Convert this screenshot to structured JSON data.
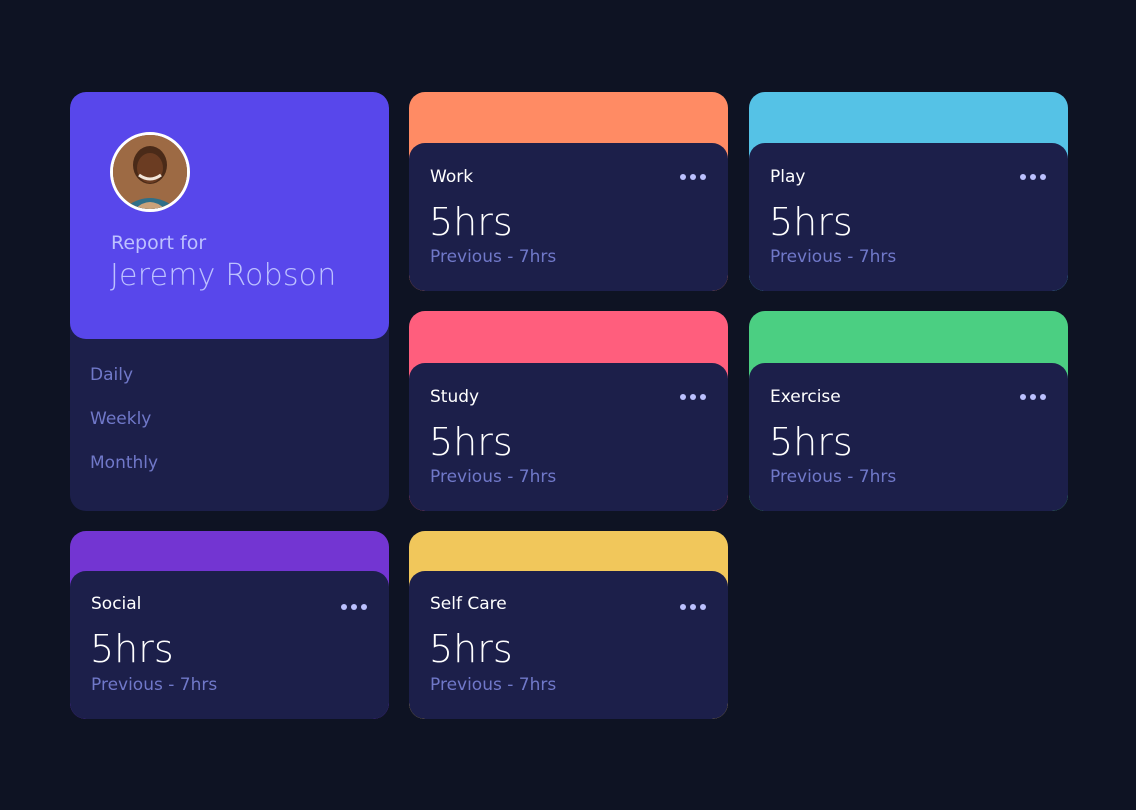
{
  "profile": {
    "report_for": "Report for",
    "name": "Jeremy Robson",
    "periods": [
      "Daily",
      "Weekly",
      "Monthly"
    ]
  },
  "colors": {
    "background": "#0e1323",
    "card": "#1c1f4a",
    "profile_accent": "#5847eb",
    "work": "#ff8b64",
    "play": "#55c2e6",
    "study": "#ff5e7d",
    "exercise": "#4bcf82",
    "social": "#7335d2",
    "self_care": "#f1c75b",
    "muted_text": "#7078c9",
    "pale_text": "#bdc1ff"
  },
  "cards": [
    {
      "title": "Work",
      "hours": "5hrs",
      "previous": "Previous - 7hrs",
      "icon": "ellipsis-icon"
    },
    {
      "title": "Play",
      "hours": "5hrs",
      "previous": "Previous - 7hrs",
      "icon": "ellipsis-icon"
    },
    {
      "title": "Study",
      "hours": "5hrs",
      "previous": "Previous - 7hrs",
      "icon": "ellipsis-icon"
    },
    {
      "title": "Exercise",
      "hours": "5hrs",
      "previous": "Previous - 7hrs",
      "icon": "ellipsis-icon"
    },
    {
      "title": "Social",
      "hours": "5hrs",
      "previous": "Previous - 7hrs",
      "icon": "ellipsis-icon"
    },
    {
      "title": "Self Care",
      "hours": "5hrs",
      "previous": "Previous - 7hrs",
      "icon": "ellipsis-icon"
    }
  ]
}
